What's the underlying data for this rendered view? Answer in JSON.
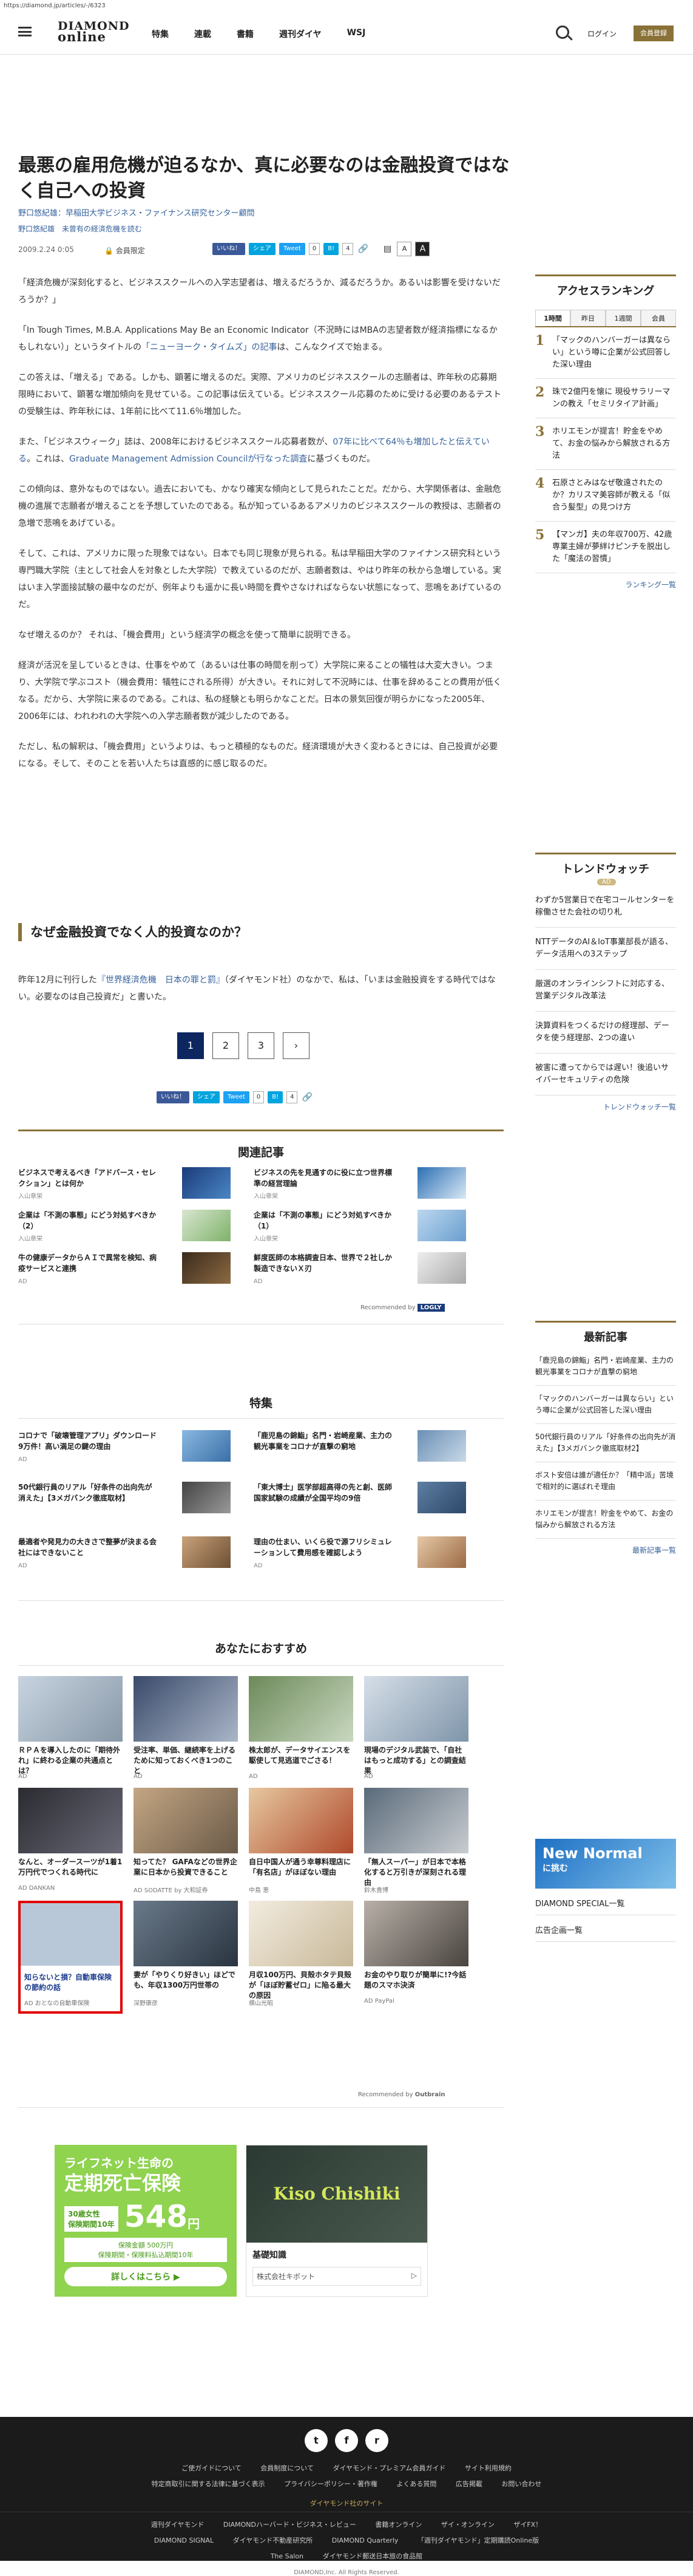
{
  "url": "https://diamond.jp/articles/-/6323",
  "header": {
    "logo_top": "DIAMOND",
    "logo_bottom": "online",
    "nav": [
      "特集",
      "連載",
      "書籍",
      "週刊ダイヤ",
      "WSJ"
    ],
    "login": "ログイン",
    "member": "会員登録"
  },
  "article": {
    "title": "最悪の雇用危機が迫るなか、真に必要なのは金融投資ではなく自己への投資",
    "author": "野口悠紀雄：早稲田大学ビジネス・ファイナンス研究センター顧問",
    "author_links": [
      "野口悠紀雄",
      "未曾有の経済危機を読む"
    ],
    "date": "2009.2.24 0:05",
    "member_only": "会員限定",
    "share": {
      "fb": "いいね！",
      "fb_count": "0",
      "hatena": "シェア",
      "tweet": "Tweet",
      "tw_count": "0",
      "b_count": "4"
    },
    "font_small": "A",
    "font_large": "A",
    "p1": "「経済危機が深刻化すると、ビジネススクールへの入学志望者は、増えるだろうか、減るだろうか。あるいは影響を受けないだろうか？」",
    "p2a": "「In Tough Times, M.B.A. Applications May Be an Economic Indicator（不況時にはMBAの志望者数が経済指標になるかもしれない）」というタイトルの",
    "p2link": "「ニューヨーク・タイムズ」の記事",
    "p2b": "は、こんなクイズで始まる。",
    "p3": "この答えは、「増える」である。しかも、顕著に増えるのだ。実際、アメリカのビジネススクールの志願者は、昨年秋の応募期限時において、顕著な増加傾向を見せている。この記事は伝えている。ビジネススクール応募のために受ける必要のあるテストの受験生は、昨年秋には、1年前に比べて11.6％増加した。",
    "p4a": "また、「ビジネスウィーク」誌は、2008年におけるビジネススクール応募者数が、",
    "p4link1": "07年に比べて64％も増加したと伝えている",
    "p4b": "。これは、",
    "p4link2": "Graduate Management Admission Councilが行なった調査",
    "p4c": "に基づくものだ。",
    "p5": "この傾向は、意外なものではない。過去においても、かなり確実な傾向として見られたことだ。だから、大学関係者は、金融危機の進展で志願者が増えることを予想していたのである。私が知っているあるアメリカのビジネススクールの教授は、志願者の急増で悲鳴をあげている。",
    "p6": "そして、これは、アメリカに限った現象ではない。日本でも同じ現象が見られる。私は早稲田大学のファイナンス研究科という専門職大学院（主として社会人を対象とした大学院）で教えているのだが、志願者数は、やはり昨年の秋から急増している。実はいま入学面接試験の最中なのだが、例年よりも遥かに長い時間を費やさなければならない状態になって、悲鳴をあげているのだ。",
    "p7": "なぜ増えるのか？ それは、「機会費用」という経済学の概念を使って簡単に説明できる。",
    "p8": "経済が活況を呈しているときは、仕事をやめて（あるいは仕事の時間を削って）大学院に来ることの犠牲は大変大きい。つまり、大学院で学ぶコスト（機会費用：犠牲にされる所得）が大きい。それに対して不況時には、仕事を辞めることの費用が低くなる。だから、大学院に来るのである。これは、私の経験とも明らかなことだ。日本の景気回復が明らかになった2005年、2006年には、われわれの大学院への入学志願者数が減少したのである。",
    "p9": "ただし、私の解釈は、「機会費用」というよりは、もっと積極的なものだ。経済環境が大きく変わるときには、自己投資が必要になる。そして、そのことを若い人たちは直感的に感じ取るのだ。",
    "subhead": "なぜ金融投資でなく人的投資なのか？",
    "p10a": "昨年12月に刊行した",
    "p10link": "『世界経済危機　日本の罪と罰』",
    "p10b": "（ダイヤモンド社）のなかで、私は、「いまは金融投資をする時代ではない。必要なのは自己投資だ」と書いた。",
    "pages": [
      "1",
      "2",
      "3",
      "›"
    ]
  },
  "related": {
    "title": "関連記事",
    "items": [
      {
        "t": "ビジネスで考えるべき「アドバース・セレクション」とは何か",
        "a": "入山章栄"
      },
      {
        "t": "ビジネスの先を見通すのに役に立つ世界標準の経営理論",
        "a": "入山章栄"
      },
      {
        "t": "企業は「不測の事態」にどう対処すべきか（2）",
        "a": "入山章栄"
      },
      {
        "t": "企業は「不測の事態」にどう対処すべきか（1）",
        "a": "入山章栄"
      },
      {
        "t": "牛の健康データからＡＩで異常を検知、病疫サービスと連携",
        "a": "AD"
      },
      {
        "t": "鮮度医師の本格調査日本、世界で２社しか製造できないＸ刃",
        "a": "AD"
      }
    ],
    "recommended_by": "Recommended by",
    "logly": "LOGLY"
  },
  "tokushu": {
    "title": "特集",
    "items": [
      {
        "t": "コロナで「破壊管理アプリ」ダウンロード9万件！高い満足の鍵の理由",
        "a": "AD"
      },
      {
        "t": "「鹿児島の錦鮨」名門・岩崎産業、主力の観光事業をコロナが直撃の窮地",
        "a": ""
      },
      {
        "t": "50代銀行員のリアル「好条件の出向先が消えた」【3メガバンク徹底取材】",
        "a": ""
      },
      {
        "t": "「東大博士」医学部超高得の先と創、医師国家試験の成績が全国平均の9倍",
        "a": ""
      },
      {
        "t": "最適者や発見力の大きさで整夢が決まる会社にはできないこと",
        "a": "AD"
      },
      {
        "t": "理由の仕まい、いくら役で源フリシミュレーションして費用感を確認しよう",
        "a": "AD"
      }
    ]
  },
  "osusume": {
    "title": "あなたにおすすめ",
    "items": [
      {
        "t": "ＲＰＡを導入したのに「期待外れ」に終わる企業の共通点とは？",
        "s": "AD"
      },
      {
        "t": "受注率、単価、継続率を上げるために知っておくべき1つのこと",
        "s": "AD"
      },
      {
        "t": "株太郎が、データサイエンスを駆使して見逃道でごさる！",
        "s": "AD"
      },
      {
        "t": "現場のデジタル武装で、「自社はもっと成功する」との調査結果",
        "s": "AD"
      },
      {
        "t": "なんと、オーダースーツが1着1万円代でつくれる時代に",
        "s": "AD DANKAN"
      },
      {
        "t": "知ってた？ GAFAなどの世界企業に日本から投資できること",
        "s": "AD SODATTE by 大和証券"
      },
      {
        "t": "自日中国人が通う幸尊料理店に「有名店」がほぼない理由",
        "s": "中島 恵"
      },
      {
        "t": "「無人スーパー」が日本で本格化すると万引きが深刻される理由",
        "s": "鈴木貴博"
      },
      {
        "t": "知らないと損？自動車保険の節約の話",
        "s": "AD おとなの自動車保険"
      },
      {
        "t": "妻が「やりくり好きい」ほどでも、年収1300万円世帯の",
        "s": "深野康彦"
      },
      {
        "t": "月収100万円、貝殻ホタテ貝殻 が「ほぼ貯蓄ゼロ」に陥る最大の原因",
        "s": "横山光昭"
      },
      {
        "t": "お金のやり取りが簡単に!?今話題のスマホ決済",
        "s": "AD PayPal"
      }
    ],
    "recommended_by": "Recommended by",
    "outbrain": "Outbrain"
  },
  "ads": {
    "insurance": {
      "line1": "ライフネット生命の",
      "line2": "定期死亡保険",
      "age": "30歳女性",
      "term": "保険期間10年",
      "price": "548",
      "unit": "円",
      "note1": "保険金額 500万円",
      "note2": "保険期間・保険料払込期間10年",
      "cta": "詳しくはこちら ▶"
    },
    "kiso": {
      "img": "Kiso Chishiki",
      "title": "基礎知識",
      "sponsor": "株式会社キボット",
      "badge": "▷"
    }
  },
  "sidebar": {
    "ranking": {
      "title": "アクセスランキング",
      "tabs": [
        "1時間",
        "昨日",
        "1週間",
        "会員"
      ],
      "items": [
        "「マックのハンバーガーは異ならい」という噂に企業が公式回答した深い理由",
        "珠で2億円を懐に 現役サラリーマンの教え「セミリタイア計画」",
        "ホリエモンが提言！貯金をやめて、お金の悩みから解放される方法",
        "石原さとみはなぜ敬遠されたのか？カリスマ美容師が教える「似合う髪型」の見つけ方",
        "【マンガ】夫の年収700万、42歳専業主婦が夢絆けピンチを脱出した「魔法の習慣」"
      ],
      "more": "ランキング一覧"
    },
    "trend": {
      "title": "トレンドウォッチ",
      "badge": "AD",
      "items": [
        "わずか5営業日で在宅コールセンターを稼働させた会社の切り札",
        "NTTデータのAI＆IoT事業部長が語る、データ活用への3ステップ",
        "厳選のオンラインシフトに対応する、営業デジタル改革法",
        "決算資料をつくるだけの経理部、データを使う経理部、2つの違い",
        "被害に遭ってからでは遅い！後追いサイバーセキュリティの危険"
      ],
      "more": "トレンドウォッチ一覧"
    },
    "latest": {
      "title": "最新記事",
      "items": [
        "「鹿児島の錦鮨」名門・岩崎産業、主力の観光事業をコロナが直撃の窮地",
        "「マックのハンバーガーは異ならい」という噂に企業が公式回答した深い理由",
        "50代銀行員のリアル「好条件の出向先が消えた」【3メガバンク徹底取材2】",
        "ボスト安倍は誰が適任か？「精中派」苦境で相対的に選ばれそ理由",
        "ホリエモンが提言！貯金をやめて、お金の悩みから解放される方法"
      ],
      "more": "最新記事一覧"
    },
    "newnormal": {
      "line1": "New Normal",
      "line2": "に挑む"
    },
    "special": "DIAMOND SPECIAL一覧",
    "adlist": "広告企画一覧"
  },
  "footer": {
    "social": [
      "t",
      "f",
      "r"
    ],
    "links1": [
      "ご使ガイドについて",
      "会員制度について",
      "ダイヤモンド・プレミアム会員ガイド",
      "サイト利用規約"
    ],
    "links2": [
      "特定商取引に関する法律に基づく表示",
      "プライバシーポリシー・著作権",
      "よくある質問",
      "広告掲載",
      "お問い合わせ"
    ],
    "site_title": "ダイヤモンド社のサイト",
    "sites1": [
      "週刊ダイヤモンド",
      "DIAMONDハーバード・ビジネス・レビュー",
      "書籍オンライン",
      "ザイ・オンライン",
      "ザイFX！"
    ],
    "sites2": [
      "DIAMOND SIGNAL",
      "ダイヤモンド不動産研究所",
      "DIAMOND Quarterly",
      "「週刊ダイヤモンド」定期購読Online版"
    ],
    "sites3": [
      "The Salon",
      "ダイヤモンド郵送日本旅の食品館"
    ],
    "copyright": "DIAMOND,Inc. All Rights Reserved."
  }
}
